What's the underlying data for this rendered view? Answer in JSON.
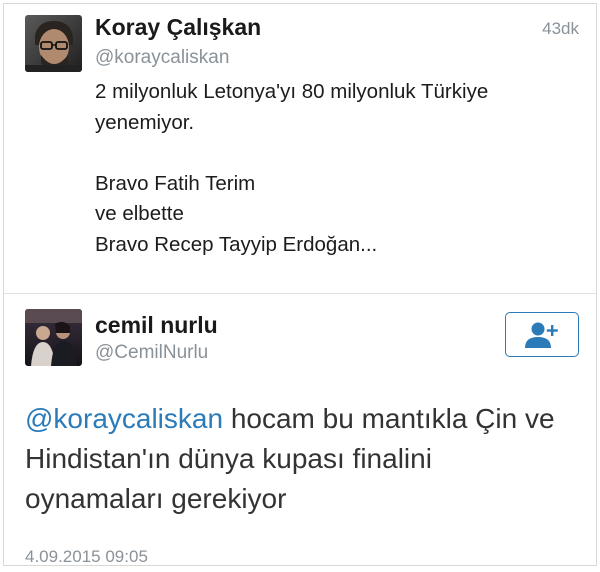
{
  "tweet1": {
    "author_name": "Koray Çalışkan",
    "author_handle": "@koraycaliskan",
    "relative_time": "43dk",
    "text": "2 milyonluk Letonya'yı 80 milyonluk Türkiye yenemiyor.\n\nBravo Fatih Terim\nve elbette\nBravo Recep Tayyip Erdoğan...",
    "avatar_icon": "profile-photo-icon"
  },
  "tweet2": {
    "author_name": "cemil nurlu",
    "author_handle": "@CemilNurlu",
    "avatar_icon": "profile-photo-icon",
    "follow_icon": "add-user-icon",
    "mention": "@koraycaliskan",
    "text_after_mention": " hocam bu mantıkla Çin ve Hindistan'ın dünya kupası finalini oynamaları  gerekiyor",
    "timestamp": "4.09.2015 09:05"
  },
  "colors": {
    "link_blue": "#2b7bb9",
    "secondary_gray": "#8a9299",
    "divider": "#dfe3e6"
  }
}
